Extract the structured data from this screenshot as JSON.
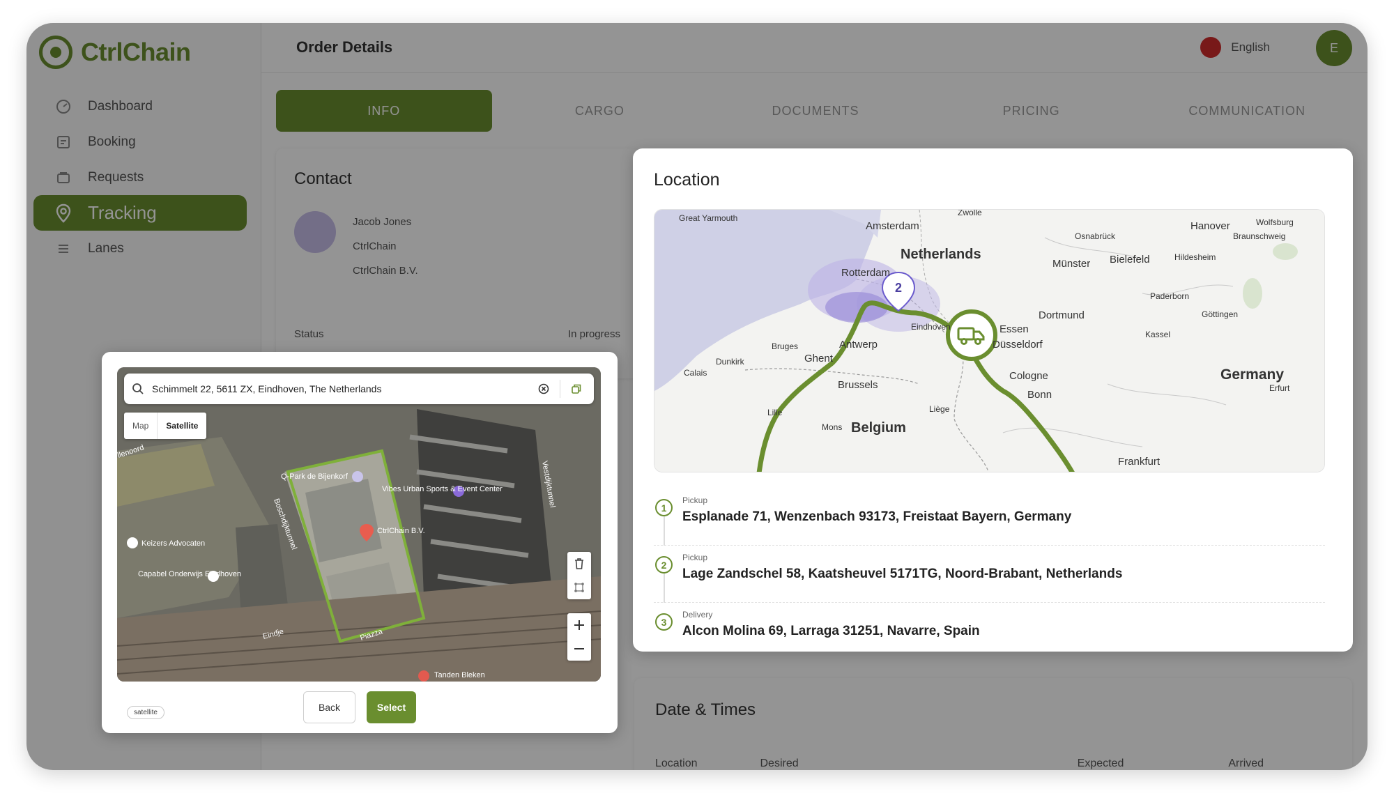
{
  "app": {
    "brand": "CtrlChain",
    "page_title": "Order Details",
    "language": "English",
    "user_initial": "E"
  },
  "sidebar": {
    "items": [
      {
        "label": "Dashboard",
        "icon": "dashboard-icon"
      },
      {
        "label": "Booking",
        "icon": "booking-icon"
      },
      {
        "label": "Requests",
        "icon": "requests-icon"
      },
      {
        "label": "Tracking",
        "icon": "location-pin-icon",
        "active": true
      },
      {
        "label": "Lanes",
        "icon": "lanes-icon"
      }
    ]
  },
  "tabs": [
    "INFO",
    "CARGO",
    "DOCUMENTS",
    "PRICING",
    "COMMUNICATION"
  ],
  "contact": {
    "title": "Contact",
    "name": "Jacob Jones",
    "company": "CtrlChain",
    "entity": "CtrlChain B.V.",
    "status_label": "Status",
    "status_value": "In progress"
  },
  "dates": {
    "title": "Date & Times",
    "columns": [
      "Location",
      "Desired",
      "Expected",
      "Arrived"
    ]
  },
  "location_modal": {
    "title": "Location",
    "map": {
      "cities": [
        "Great Yarmouth",
        "Amsterdam",
        "Zwolle",
        "Osnabrück",
        "Hanover",
        "Wolfsburg",
        "Braunschweig",
        "Netherlands",
        "Rotterdam",
        "Münster",
        "Bielefeld",
        "Hildesheim",
        "Paderborn",
        "Dortmund",
        "Göttingen",
        "Essen",
        "Düsseldorf",
        "Kassel",
        "Bruges",
        "Ghent",
        "Antwerp",
        "Eindhoven",
        "Dunkirk",
        "Calais",
        "Brussels",
        "Cologne",
        "Bonn",
        "Germany",
        "Erfurt",
        "Liège",
        "Mons",
        "Belgium",
        "Frankfurt",
        "Lille"
      ],
      "cluster_count": "2",
      "route_color": "#6a8e2f",
      "truck_icon": "truck-icon"
    },
    "stops": [
      {
        "num": "1",
        "type": "Pickup",
        "address": "Esplanade 71, Wenzenbach 93173, Freistaat Bayern, Germany"
      },
      {
        "num": "2",
        "type": "Pickup",
        "address": "Lage Zandschel 58, Kaatsheuvel 5171TG, Noord-Brabant, Netherlands"
      },
      {
        "num": "3",
        "type": "Delivery",
        "address": "Alcon Molina 69, Larraga 31251, Navarre, Spain"
      }
    ]
  },
  "picker_modal": {
    "search_value": "Schimmelt 22, 5611 ZX, Eindhoven, The Netherlands",
    "map_type": {
      "map": "Map",
      "satellite": "Satellite"
    },
    "labels": {
      "place1": "Q-Park de Bijenkorf",
      "place2": "Vibes Urban Sports & Event Center",
      "place3": "CtrlChain B.V.",
      "place4": "Keizers Advocaten",
      "place5": "Capabel Onderwijs Eindhoven",
      "street1": "Boschdijktunnel",
      "street2": "Vestdijktunnel",
      "street3": "Piazza",
      "street4": "Eindje",
      "street5": "Tanden Bleken",
      "area1": "llenoord"
    },
    "chip": "satellite",
    "back_label": "Back",
    "select_label": "Select",
    "accent": "#6a8e2f"
  }
}
